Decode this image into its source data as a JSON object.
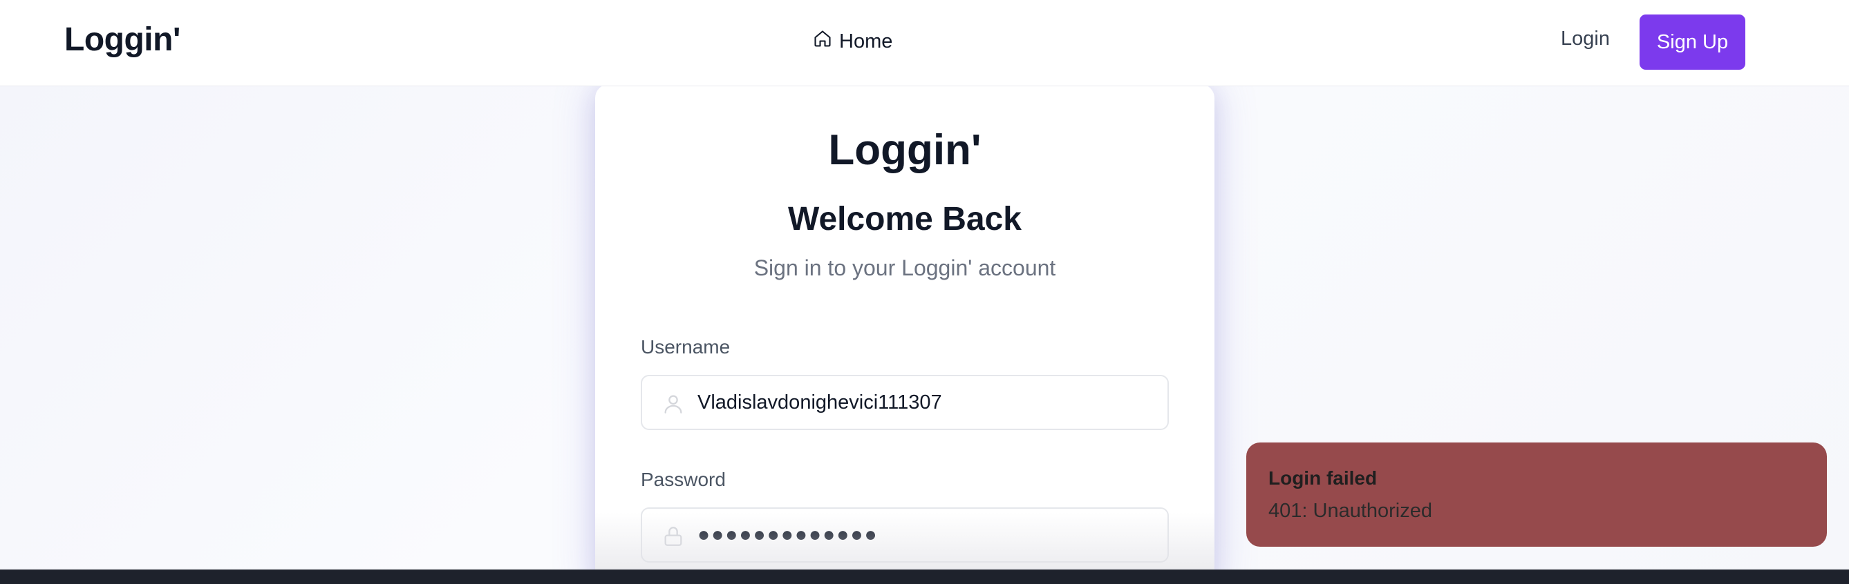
{
  "navbar": {
    "brand": "Loggin'",
    "home_label": "Home",
    "login_label": "Login",
    "signup_label": "Sign Up"
  },
  "card": {
    "brand": "Loggin'",
    "title": "Welcome Back",
    "subtitle": "Sign in to your Loggin' account",
    "username_label": "Username",
    "username_value": "Vladislavdonighevici111307",
    "password_label": "Password",
    "password_value": "●●●●●●●●●●●●●"
  },
  "toast": {
    "title": "Login failed",
    "description": "401: Unauthorized"
  },
  "icons": {
    "home": "home-icon",
    "user": "user-icon",
    "lock": "lock-icon"
  },
  "colors": {
    "accent": "#7c3aed",
    "toast_bg": "#964a4c",
    "text": "#111827"
  }
}
